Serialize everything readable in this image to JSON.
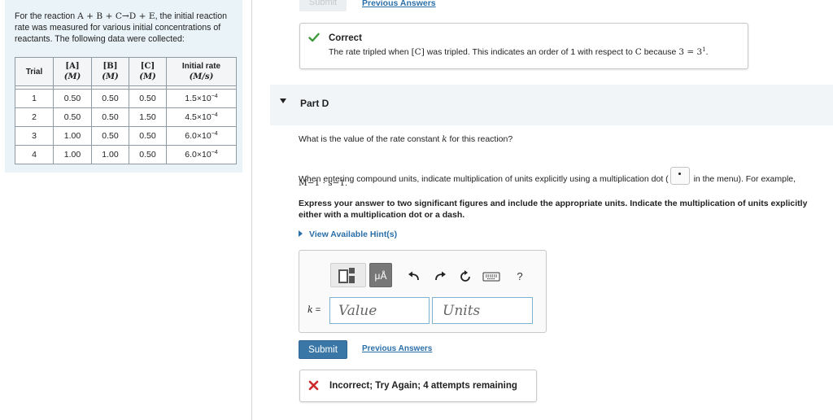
{
  "problem": {
    "intro_line1": "For the reaction",
    "reaction": "A + B + C→D + E",
    "intro_line1_end": ", the initial",
    "intro_rest": "reaction rate was measured for various initial concentrations of reactants. The following data were collected:",
    "table": {
      "headers": {
        "trial": "Trial",
        "a": "[A]",
        "a_unit": "(M)",
        "b": "[B]",
        "b_unit": "(M)",
        "c": "[C]",
        "c_unit": "(M)",
        "rate": "Initial rate",
        "rate_unit": "(M/s)"
      },
      "rows": [
        {
          "trial": "1",
          "a": "0.50",
          "b": "0.50",
          "c": "0.50",
          "rate_base": "1.5×10",
          "rate_exp": "−4"
        },
        {
          "trial": "2",
          "a": "0.50",
          "b": "0.50",
          "c": "1.50",
          "rate_base": "4.5×10",
          "rate_exp": "−4"
        },
        {
          "trial": "3",
          "a": "1.00",
          "b": "0.50",
          "c": "0.50",
          "rate_base": "6.0×10",
          "rate_exp": "−4"
        },
        {
          "trial": "4",
          "a": "1.00",
          "b": "1.00",
          "c": "0.50",
          "rate_base": "6.0×10",
          "rate_exp": "−4"
        }
      ]
    }
  },
  "prev_part": {
    "submit_label": "Submit",
    "previous_answers_label": "Previous Answers",
    "feedback_title": "Correct",
    "feedback_pre": "The rate tripled when ",
    "feedback_var": "[C]",
    "feedback_mid": " was tripled. This indicates an order of 1 with respect to ",
    "feedback_var2": "C",
    "feedback_mid2": " because ",
    "feedback_math": "3 = 3",
    "feedback_exp": "1",
    "feedback_end": "."
  },
  "part": {
    "title": "Part D",
    "question_pre": "What is the value of the rate constant ",
    "question_var": "k",
    "question_post": " for this reaction?",
    "units_note_pre": "When entering compound units, indicate multiplication of units explicitly using a multiplication dot (",
    "units_note_post": " in the menu). For example,",
    "example_units": "M−1 · s−1",
    "example_end": ".",
    "instructions": "Express your answer to two significant figures and include the appropriate units. Indicate the multiplication of units explicitly either with a multiplication dot or a dash.",
    "hints_label": "View Available Hint(s)",
    "toolbar": {
      "mu_label": "μÅ",
      "help_label": "?"
    },
    "answer_label": "k =",
    "value_placeholder": "Value",
    "units_placeholder": "Units",
    "submit_label": "Submit",
    "previous_answers_label": "Previous Answers",
    "feedback": "Incorrect; Try Again; 4 attempts remaining"
  },
  "colors": {
    "accent": "#3a77a7",
    "link": "#2b6fa8",
    "correct": "#3f9a3f",
    "incorrect": "#cc2a2a"
  },
  "icons": [
    "check-icon",
    "x-icon",
    "undo-icon",
    "redo-icon",
    "reset-icon",
    "keyboard-icon",
    "help-icon",
    "templates-icon",
    "caret-down-icon",
    "caret-right-icon"
  ]
}
